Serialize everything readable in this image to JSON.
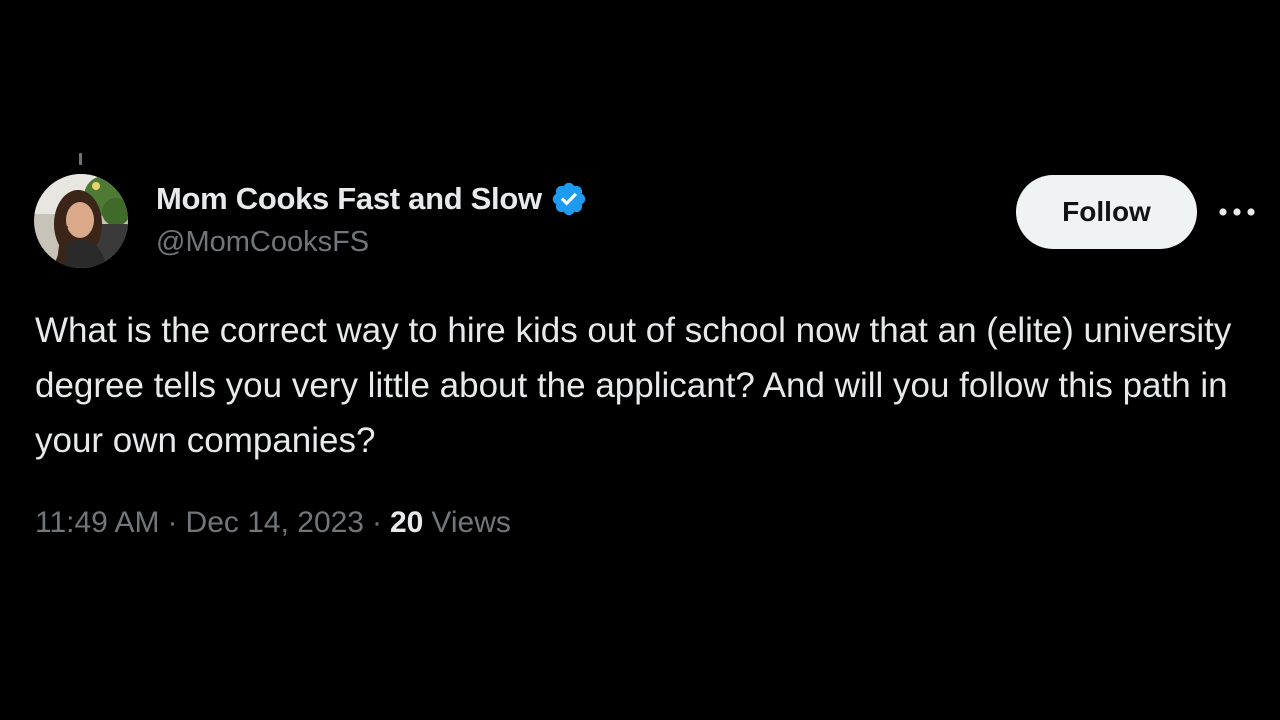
{
  "author": {
    "display_name": "Mom Cooks Fast and Slow",
    "handle": "@MomCooksFS",
    "verified": true,
    "avatar_icon": "profile-photo"
  },
  "actions": {
    "follow_label": "Follow",
    "more_icon": "more-horizontal-icon"
  },
  "tweet": {
    "text": "What is the correct way to hire kids out of school now that an (elite) university degree tells you very little about the applicant? And will you follow this path in your own companies?"
  },
  "meta": {
    "time": "11:49 AM",
    "separator": "·",
    "date": "Dec 14, 2023",
    "views_count": "20",
    "views_label": "Views"
  },
  "colors": {
    "background": "#000000",
    "primary_text": "#e7e9ea",
    "secondary_text": "#71767b",
    "verified_badge": "#1d9bf0",
    "follow_button_bg": "#eff3f4",
    "follow_button_text": "#0f1419"
  }
}
